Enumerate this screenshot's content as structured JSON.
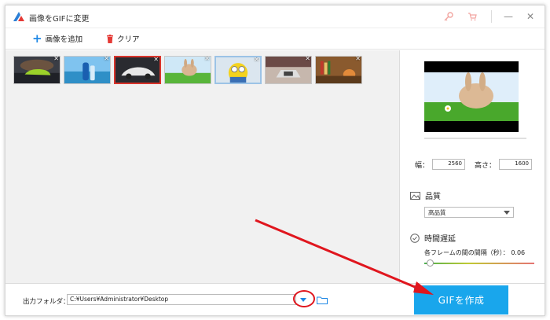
{
  "window": {
    "title": "画像をGIFに変更",
    "minimize_glyph": "—",
    "close_glyph": "✕"
  },
  "toolbar": {
    "add_label": "画像を追加",
    "clear_label": "クリア"
  },
  "thumbnails": [
    {
      "name": "car-green",
      "state": "normal"
    },
    {
      "name": "bottles-sea",
      "state": "normal"
    },
    {
      "name": "white-car",
      "state": "selected"
    },
    {
      "name": "rabbit-grass",
      "state": "normal"
    },
    {
      "name": "minion",
      "state": "hover"
    },
    {
      "name": "laptop",
      "state": "normal"
    },
    {
      "name": "books",
      "state": "normal"
    }
  ],
  "settings": {
    "width_label": "幅：",
    "width_value": "2560",
    "height_label": "高さ：",
    "height_value": "1600",
    "quality_title": "品質",
    "quality_value": "高品質",
    "delay_title": "時間遅延",
    "delay_label": "各フレームの間の間隔（秒）：",
    "delay_value": "0.06",
    "delay_slider_fraction": 0.05
  },
  "footer": {
    "output_label": "出力フォルダ：",
    "output_path": "C:¥Users¥Administrator¥Desktop",
    "create_button": "GIFを作成"
  },
  "colors": {
    "accent": "#19a6ec",
    "annotation": "#e0161e",
    "selected_border": "#d9342b"
  },
  "icons": [
    "app-logo-icon",
    "key-icon",
    "cart-icon",
    "minimize-icon",
    "close-icon",
    "plus-icon",
    "trash-icon",
    "image-icon",
    "clock-icon",
    "chevron-down-icon",
    "folder-icon"
  ]
}
